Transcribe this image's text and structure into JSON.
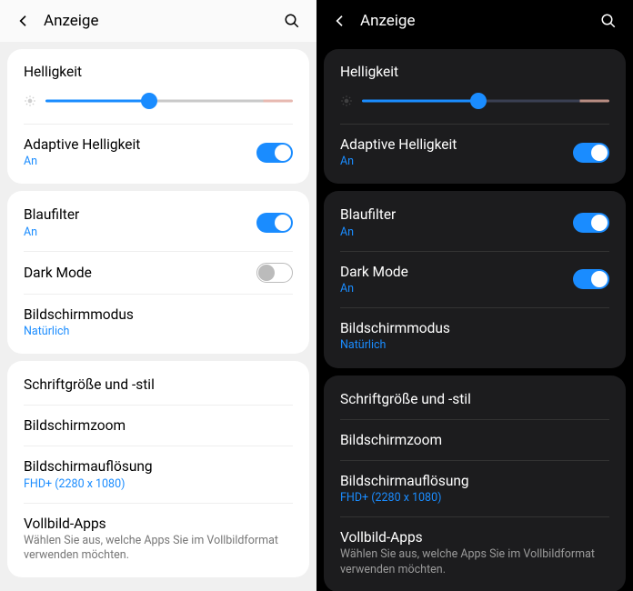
{
  "light": {
    "header": {
      "title": "Anzeige"
    },
    "brightness": {
      "label": "Helligkeit",
      "value_pct": 42
    },
    "adaptive": {
      "label": "Adaptive Helligkeit",
      "state": "An",
      "on": true
    },
    "bluefilter": {
      "label": "Blaufilter",
      "state": "An",
      "on": true
    },
    "darkmode": {
      "label": "Dark Mode",
      "state": "",
      "on": false
    },
    "screenmode": {
      "label": "Bildschirmmodus",
      "value": "Natürlich"
    },
    "fontstyle": {
      "label": "Schriftgröße und -stil"
    },
    "zoom": {
      "label": "Bildschirmzoom"
    },
    "resolution": {
      "label": "Bildschirmauflösung",
      "value": "FHD+ (2280 x 1080)"
    },
    "fullscreen": {
      "label": "Vollbild-Apps",
      "desc": "Wählen Sie aus, welche Apps Sie im Vollbildformat verwenden möchten."
    }
  },
  "dark": {
    "header": {
      "title": "Anzeige"
    },
    "brightness": {
      "label": "Helligkeit",
      "value_pct": 47
    },
    "adaptive": {
      "label": "Adaptive Helligkeit",
      "state": "An",
      "on": true
    },
    "bluefilter": {
      "label": "Blaufilter",
      "state": "An",
      "on": true
    },
    "darkmode": {
      "label": "Dark Mode",
      "state": "An",
      "on": true
    },
    "screenmode": {
      "label": "Bildschirmmodus",
      "value": "Natürlich"
    },
    "fontstyle": {
      "label": "Schriftgröße und -stil"
    },
    "zoom": {
      "label": "Bildschirmzoom"
    },
    "resolution": {
      "label": "Bildschirmauflösung",
      "value": "FHD+ (2280 x 1080)"
    },
    "fullscreen": {
      "label": "Vollbild-Apps",
      "desc": "Wählen Sie aus, welche Apps Sie im Vollbildformat verwenden möchten."
    }
  }
}
